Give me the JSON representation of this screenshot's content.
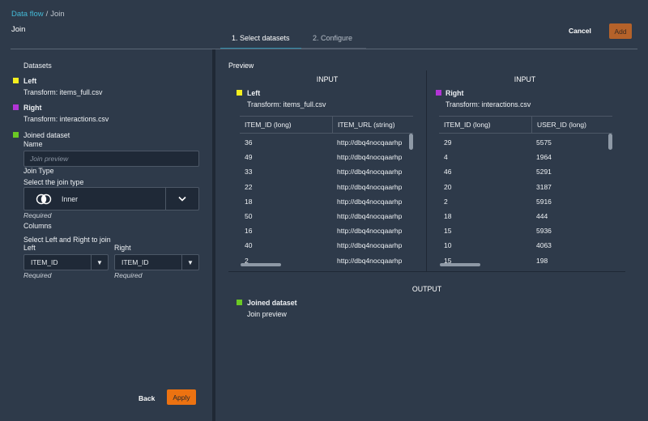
{
  "breadcrumb": {
    "parent": "Data flow",
    "separator": "/",
    "current": "Join"
  },
  "page_title": "Join",
  "tabs": [
    {
      "label": "1. Select datasets",
      "active": true
    },
    {
      "label": "2. Configure",
      "active": false
    }
  ],
  "header_actions": {
    "cancel": "Cancel",
    "add": "Add"
  },
  "colors": {
    "left": "#f5ef1e",
    "right": "#b234d6",
    "joined": "#6bc924",
    "accent": "#ec7211",
    "link": "#44b9d6"
  },
  "left_panel": {
    "datasets_heading": "Datasets",
    "left": {
      "label": "Left",
      "transform": "Transform: items_full.csv"
    },
    "right": {
      "label": "Right",
      "transform": "Transform: interactions.csv"
    },
    "joined": {
      "label": "Joined dataset",
      "name_label": "Name",
      "name_placeholder": "Join preview"
    },
    "join_type": {
      "label": "Join Type",
      "sublabel": "Select the join type",
      "value": "Inner",
      "required": "Required"
    },
    "columns": {
      "label": "Columns",
      "sublabel": "Select Left and Right to join",
      "left_label": "Left",
      "left_value": "ITEM_ID",
      "left_required": "Required",
      "right_label": "Right",
      "right_value": "ITEM_ID",
      "right_required": "Required"
    },
    "back": "Back",
    "apply": "Apply"
  },
  "preview": {
    "heading": "Preview",
    "left_input": {
      "heading": "INPUT",
      "label": "Left",
      "transform": "Transform: items_full.csv",
      "columns": [
        "ITEM_ID (long)",
        "ITEM_URL (string)"
      ],
      "rows": [
        [
          "36",
          "http://dbq4nocqaarhp"
        ],
        [
          "49",
          "http://dbq4nocqaarhp"
        ],
        [
          "33",
          "http://dbq4nocqaarhp"
        ],
        [
          "22",
          "http://dbq4nocqaarhp"
        ],
        [
          "18",
          "http://dbq4nocqaarhp"
        ],
        [
          "50",
          "http://dbq4nocqaarhp"
        ],
        [
          "16",
          "http://dbq4nocqaarhp"
        ],
        [
          "40",
          "http://dbq4nocqaarhp"
        ],
        [
          "2",
          "http://dbq4nocqaarhp"
        ]
      ]
    },
    "right_input": {
      "heading": "INPUT",
      "label": "Right",
      "transform": "Transform: interactions.csv",
      "columns": [
        "ITEM_ID (long)",
        "USER_ID (long)"
      ],
      "rows": [
        [
          "29",
          "5575"
        ],
        [
          "4",
          "1964"
        ],
        [
          "46",
          "5291"
        ],
        [
          "20",
          "3187"
        ],
        [
          "2",
          "5916"
        ],
        [
          "18",
          "444"
        ],
        [
          "15",
          "5936"
        ],
        [
          "10",
          "4063"
        ],
        [
          "15",
          "198"
        ]
      ]
    },
    "output": {
      "heading": "OUTPUT",
      "label": "Joined dataset",
      "sublabel": "Join preview"
    }
  }
}
